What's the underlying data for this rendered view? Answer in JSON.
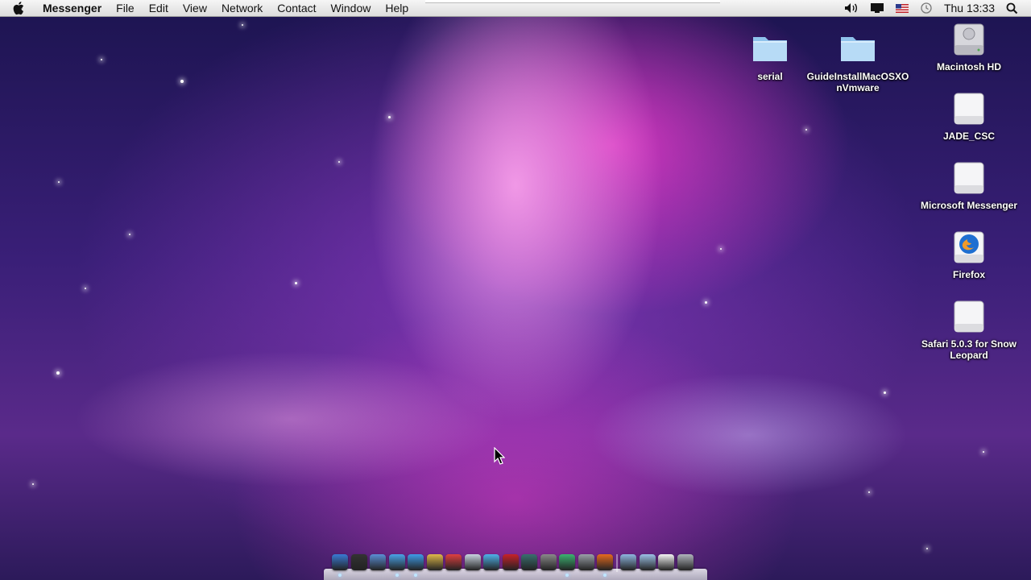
{
  "menubar": {
    "app_name": "Messenger",
    "menus": [
      "File",
      "Edit",
      "View",
      "Network",
      "Contact",
      "Window",
      "Help"
    ],
    "clock": "Thu 13:33",
    "status_icons": [
      "volume-icon",
      "display-icon",
      "us-flag-icon",
      "time-machine-icon",
      "spotlight-icon"
    ]
  },
  "desktop": {
    "icons": [
      {
        "label": "serial",
        "type": "folder-icon"
      },
      {
        "label": "GuideInstallMacOSXOnVmware",
        "type": "folder-icon"
      },
      {
        "label": "Macintosh HD",
        "type": "hard-disk-icon"
      },
      {
        "label": "JADE_CSC",
        "type": "disk-icon"
      },
      {
        "label": "Microsoft Messenger",
        "type": "disk-icon"
      },
      {
        "label": "Firefox",
        "type": "firefox-disk-icon"
      },
      {
        "label": "Safari 5.0.3 for Snow Leopard",
        "type": "disk-icon"
      }
    ]
  },
  "dock": {
    "items": [
      {
        "name": "finder-icon",
        "color": "#3a7bd5"
      },
      {
        "name": "dashboard-icon",
        "color": "#333333"
      },
      {
        "name": "mail-icon",
        "color": "#5b8fd6"
      },
      {
        "name": "safari-icon",
        "color": "#4aa3e8"
      },
      {
        "name": "ichat-icon",
        "color": "#3f9be8"
      },
      {
        "name": "address-book-icon",
        "color": "#e0b84a"
      },
      {
        "name": "ical-icon",
        "color": "#e04040"
      },
      {
        "name": "preview-icon",
        "color": "#c9d4e0"
      },
      {
        "name": "itunes-icon",
        "color": "#4fb2ea"
      },
      {
        "name": "photo-booth-icon",
        "color": "#c8222a"
      },
      {
        "name": "time-machine-icon",
        "color": "#3a6f6f"
      },
      {
        "name": "system-preferences-icon",
        "color": "#8a8a8a"
      },
      {
        "name": "messenger-icon",
        "color": "#3cb371"
      },
      {
        "name": "utilities-icon",
        "color": "#9aa0a8"
      },
      {
        "name": "firefox-icon",
        "color": "#e66a1f"
      },
      {
        "name": "applications-folder-icon",
        "color": "#8fb6e0"
      },
      {
        "name": "documents-folder-icon",
        "color": "#9cc0e6"
      },
      {
        "name": "document-icon",
        "color": "#f4f4f4"
      },
      {
        "name": "trash-icon",
        "color": "#b0b4bc"
      }
    ]
  }
}
